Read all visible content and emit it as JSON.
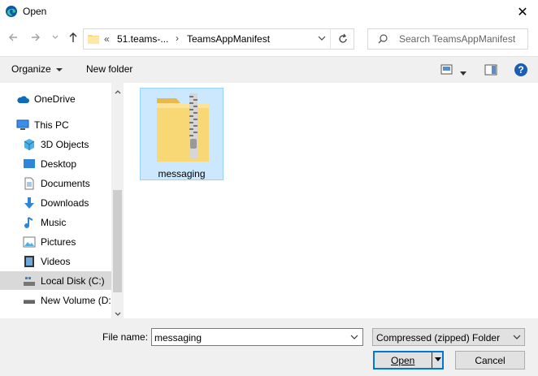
{
  "window": {
    "title": "Open"
  },
  "nav": {
    "back_icon": "arrow-left-icon",
    "forward_icon": "arrow-right-icon",
    "recent_icon": "chevron-down-icon",
    "up_icon": "arrow-up-icon"
  },
  "address": {
    "overflow": "«",
    "crumbs": [
      "51.teams-...",
      "TeamsAppManifest"
    ],
    "separator": "›"
  },
  "search": {
    "placeholder": "Search TeamsAppManifest"
  },
  "toolbar": {
    "organize": "Organize",
    "new_folder": "New folder"
  },
  "sidebar": {
    "items": [
      {
        "label": "OneDrive",
        "icon": "cloud-icon"
      },
      {
        "label": "This PC",
        "icon": "monitor-icon"
      },
      {
        "label": "3D Objects",
        "icon": "cube-icon"
      },
      {
        "label": "Desktop",
        "icon": "desktop-icon"
      },
      {
        "label": "Documents",
        "icon": "document-icon"
      },
      {
        "label": "Downloads",
        "icon": "download-icon"
      },
      {
        "label": "Music",
        "icon": "music-icon"
      },
      {
        "label": "Pictures",
        "icon": "pictures-icon"
      },
      {
        "label": "Videos",
        "icon": "video-icon"
      },
      {
        "label": "Local Disk (C:)",
        "icon": "drive-icon"
      },
      {
        "label": "New Volume (D:",
        "icon": "drive-icon"
      }
    ],
    "selected": "Local Disk (C:)"
  },
  "files": [
    {
      "name": "messaging",
      "type": "zip-folder-icon"
    }
  ],
  "bottom": {
    "filename_label": "File name:",
    "filename_value": "messaging",
    "filetype_value": "Compressed (zipped) Folder",
    "open_label": "Open",
    "cancel_label": "Cancel"
  },
  "colors": {
    "accent": "#0078d7",
    "selection": "#cce8ff",
    "help": "#1a5fb4"
  }
}
